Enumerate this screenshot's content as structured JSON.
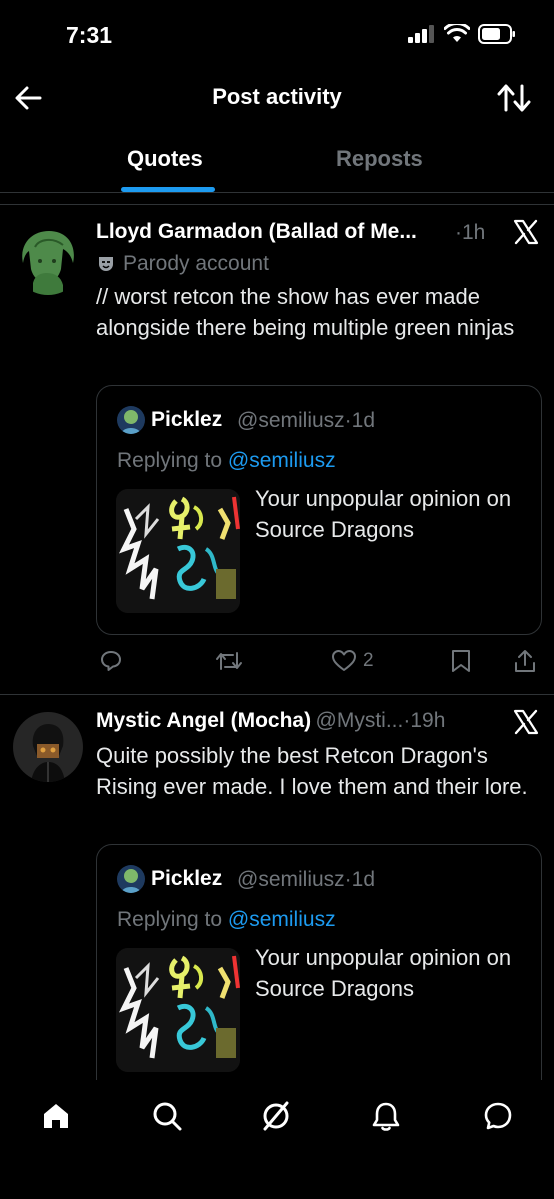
{
  "status": {
    "time": "7:31"
  },
  "header": {
    "title": "Post activity"
  },
  "tabs": [
    {
      "label": "Quotes"
    },
    {
      "label": "Reposts"
    }
  ],
  "posts": [
    {
      "name": "Lloyd Garmadon (Ballad of Me...",
      "time": "1h",
      "badge": "Parody account",
      "text": "// worst retcon the show has ever made alongside there being multiple green ninjas",
      "quote": {
        "name": "Picklez",
        "handle": "@semiliusz",
        "time": "1d",
        "replying_prefix": "Replying to",
        "replying_to": "@semiliusz",
        "text": "Your unpopular opinion on Source Dragons"
      },
      "likes": "2"
    },
    {
      "name": "Mystic Angel (Mocha)",
      "handle": "@Mysti...",
      "time": "19h",
      "text": "Quite possibly the best Retcon Dragon's Rising ever made. I love them and their lore.",
      "quote": {
        "name": "Picklez",
        "handle": "@semiliusz",
        "time": "1d",
        "replying_prefix": "Replying to",
        "replying_to": "@semiliusz",
        "text": "Your unpopular opinion on Source Dragons"
      }
    }
  ],
  "colors": {
    "accent": "#1d9bf0",
    "muted": "#71767b",
    "background": "#000000",
    "divider": "#2f3336"
  },
  "icons": [
    "back-arrow-icon",
    "sort-icon",
    "parody-mask-icon",
    "x-logo-icon",
    "reply-icon",
    "repost-icon",
    "like-icon",
    "bookmark-icon",
    "share-icon",
    "home-icon",
    "search-icon",
    "grok-icon",
    "notifications-icon",
    "messages-icon"
  ]
}
